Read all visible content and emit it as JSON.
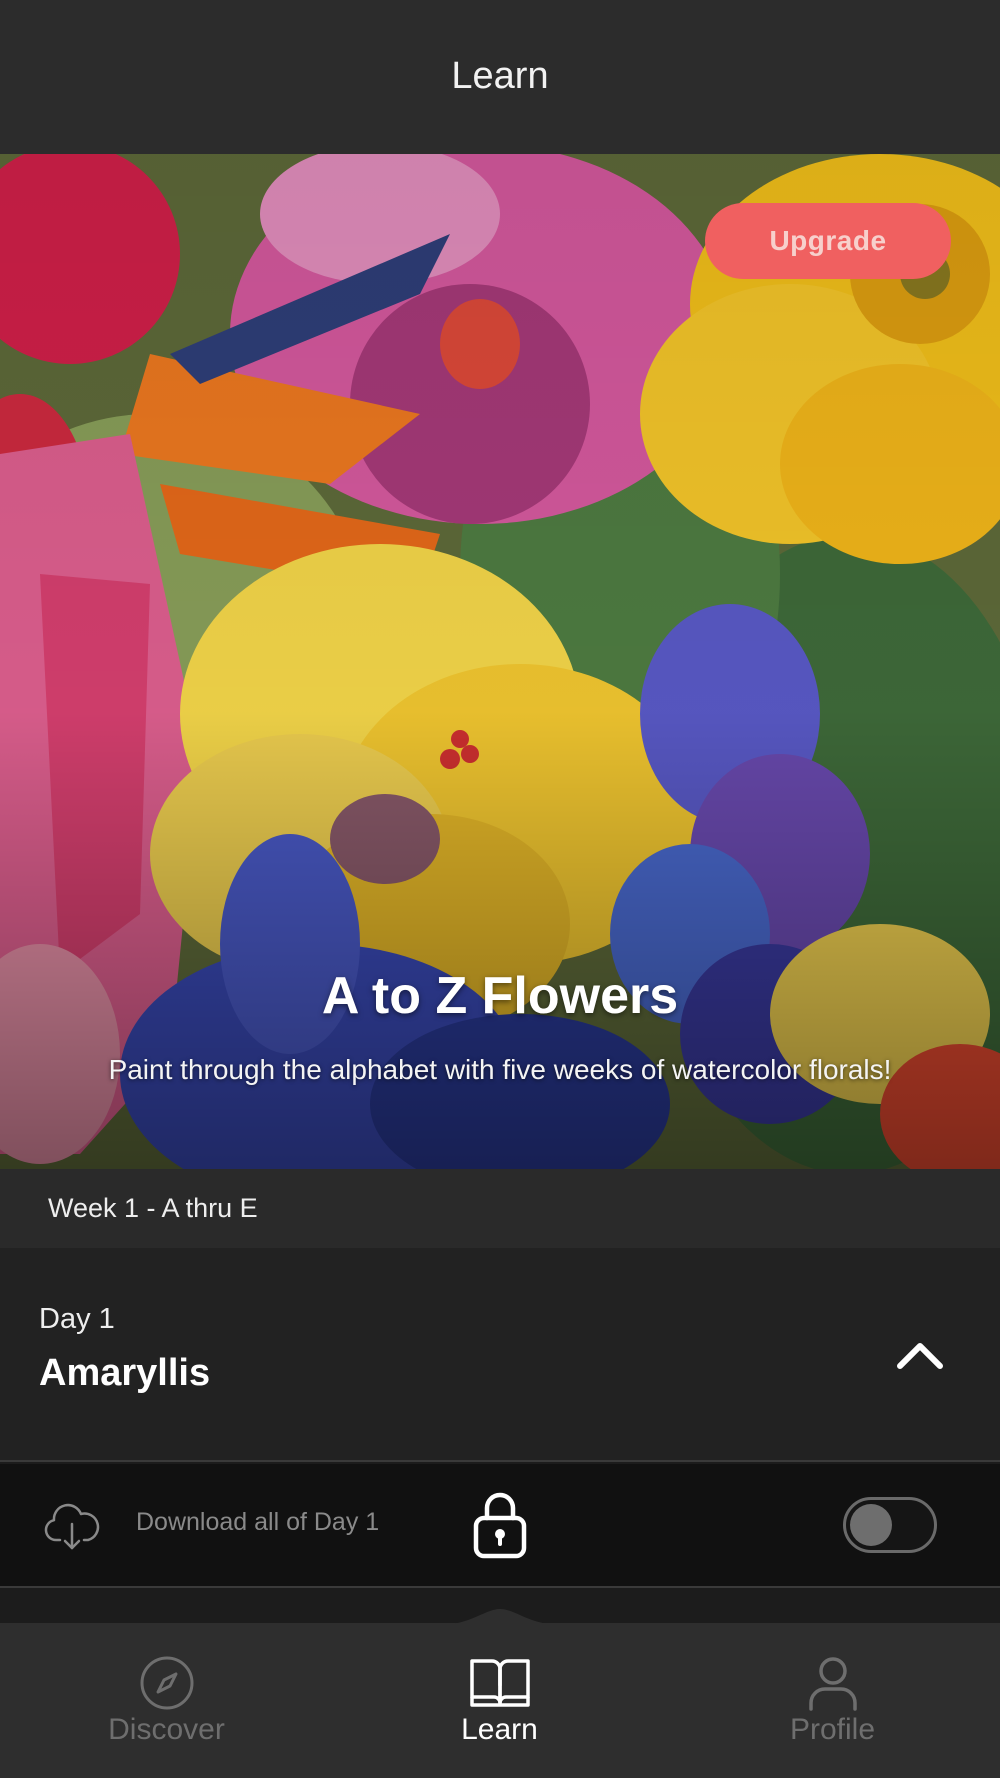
{
  "header": {
    "title": "Learn"
  },
  "hero": {
    "upgrade_label": "Upgrade",
    "title": "A to Z Flowers",
    "subtitle": "Paint through the alphabet with five weeks of watercolor florals!"
  },
  "week": {
    "label": "Week 1 - A thru E"
  },
  "day": {
    "number_label": "Day 1",
    "title": "Amaryllis",
    "toggle_icon": "chevron-up-icon"
  },
  "download": {
    "label": "Download all of Day 1",
    "icon": "cloud-download-icon",
    "lock_icon": "lock-icon",
    "toggle_on": false
  },
  "bottom_nav": {
    "items": [
      {
        "label": "Discover",
        "icon": "compass-icon",
        "active": false
      },
      {
        "label": "Learn",
        "icon": "book-icon",
        "active": true
      },
      {
        "label": "Profile",
        "icon": "person-icon",
        "active": false
      }
    ]
  },
  "colors": {
    "accent": "#f06060",
    "header_bg": "#2c2c2c",
    "nav_bg": "#2e2e2e",
    "active_nav": "#ffffff",
    "inactive_nav": "#6e6e6e"
  }
}
